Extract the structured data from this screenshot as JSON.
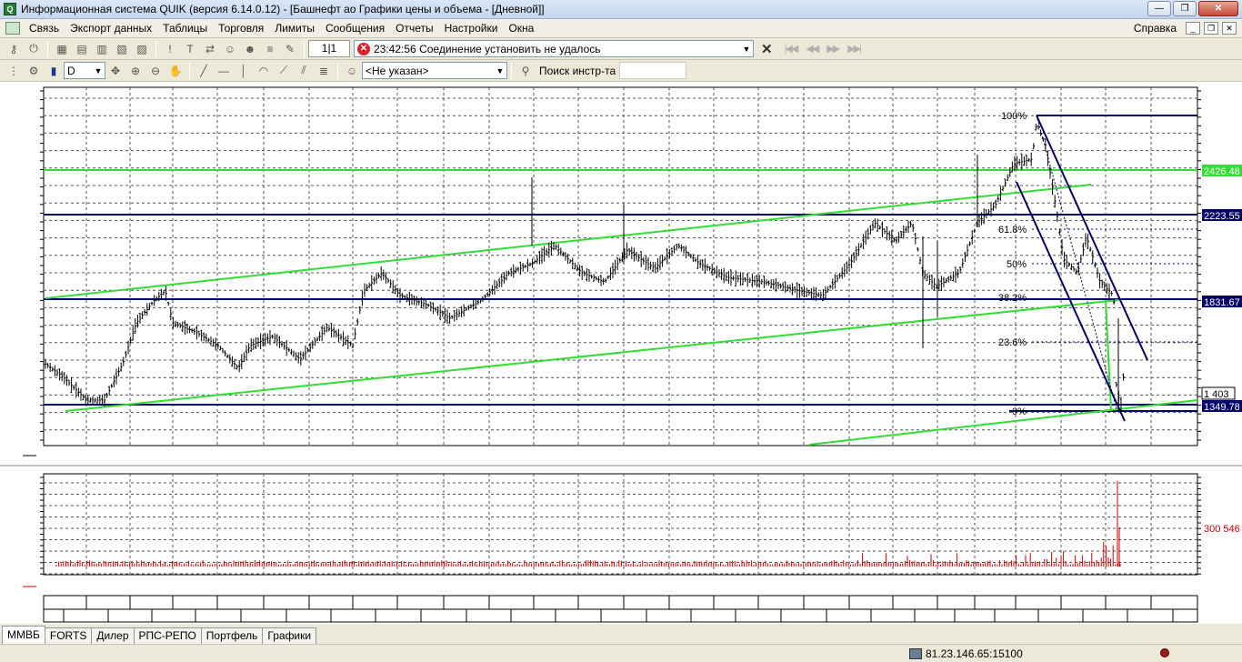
{
  "window": {
    "title": "Информационная система QUIK (версия 6.14.0.12) - [Башнефт ао Графики цены и объема - [Дневной]]"
  },
  "menu": {
    "items": [
      "Связь",
      "Экспорт данных",
      "Таблицы",
      "Торговля",
      "Лимиты",
      "Сообщения",
      "Отчеты",
      "Настройки",
      "Окна"
    ],
    "help": "Справка"
  },
  "toolbar": {
    "counter": "1|1",
    "status_time": "23:42:56",
    "status_message": "Соединение установить не удалось",
    "interval": "D",
    "client": "<Не указан>",
    "search_label": "Поиск инстр-та",
    "search_value": ""
  },
  "price_chart": {
    "level_labels": {
      "top": "2426.48",
      "upper": "2223.55",
      "middle": "1831.67",
      "bottom": "1349.78"
    },
    "current_label": "1 403",
    "fib_labels": [
      "100%",
      "61.8%",
      "50%",
      "38.2%",
      "23.6%",
      "0%"
    ],
    "colors": {
      "level": "#000066",
      "trend": "#33dd33",
      "grid": "#555555"
    }
  },
  "volume_chart": {
    "label": "300 546",
    "color": "#cc0000"
  },
  "tabs": [
    "ММВБ",
    "FORTS",
    "Дилер",
    "РПС-РЕПО",
    "Портфель",
    "Графики"
  ],
  "status": {
    "connection": "81.23.146.65:15100"
  }
}
